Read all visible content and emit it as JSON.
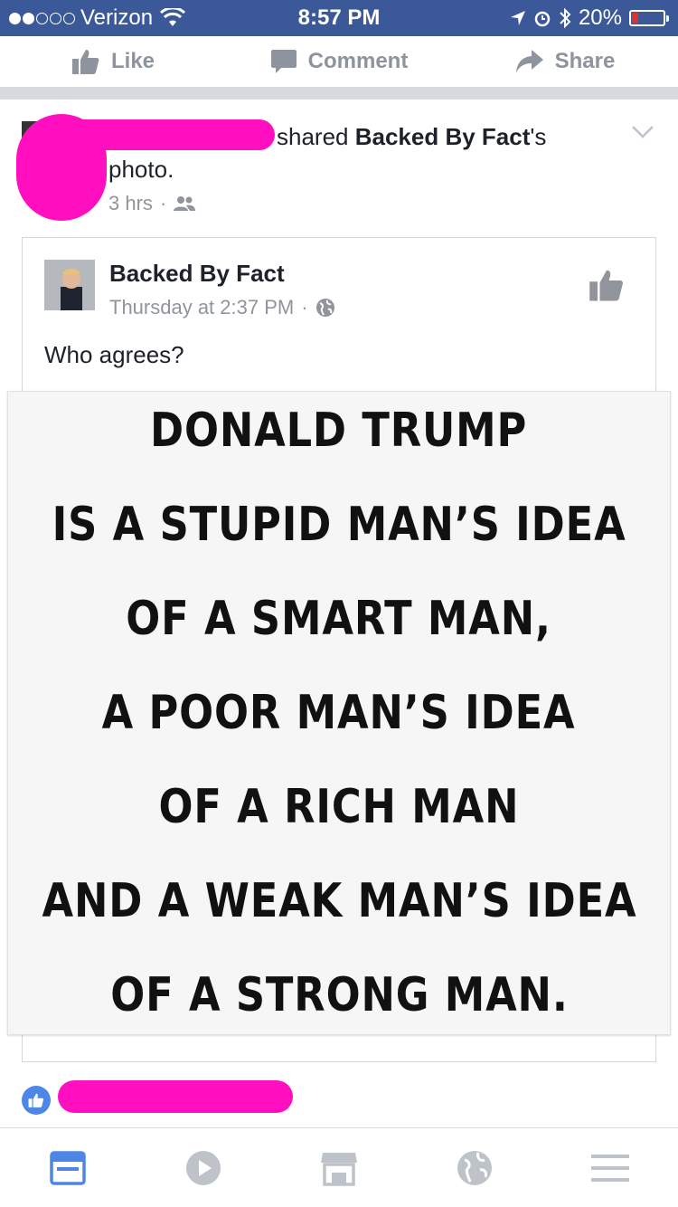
{
  "status_bar": {
    "carrier": "Verizon",
    "time": "8:57 PM",
    "battery": "20%",
    "battery_level": 0.2
  },
  "actions": {
    "like": "Like",
    "comment": "Comment",
    "share": "Share"
  },
  "post": {
    "shared_text": "shared",
    "page_name": "Backed By Fact",
    "possessive": "'s",
    "object": "photo.",
    "time": "3 hrs",
    "audience_icon": "friends-icon"
  },
  "shared_card": {
    "page_name": "Backed By Fact",
    "time": "Thursday at 2:37 PM",
    "audience_icon": "globe-icon",
    "caption": "Who agrees?"
  },
  "meme": {
    "lines": [
      "DONALD TRUMP",
      "IS A STUPID MAN’S IDEA",
      "OF A SMART MAN,",
      "A POOR MAN’S IDEA",
      "OF A RICH MAN",
      "AND A WEAK MAN’S IDEA",
      "OF A STRONG MAN."
    ]
  },
  "colors": {
    "brand": "#3b5998",
    "redaction": "#ff0fbf",
    "active_tab": "#4e86e6"
  },
  "tabbar": {
    "items": [
      "news-feed-icon",
      "video-icon",
      "marketplace-icon",
      "notifications-globe-icon",
      "menu-icon"
    ]
  }
}
